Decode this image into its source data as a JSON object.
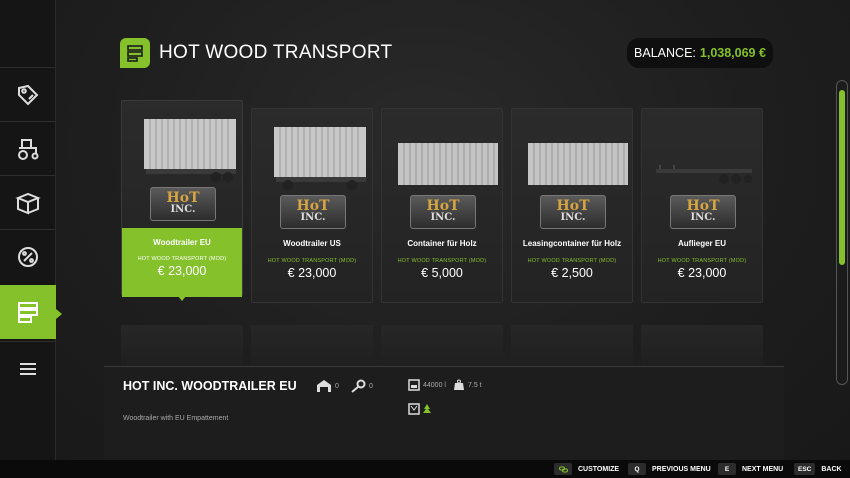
{
  "header": {
    "title": "HOT WOOD TRANSPORT",
    "balance_label": "BALANCE:",
    "balance_value": "1,038,069 €"
  },
  "colors": {
    "accent": "#84c12b",
    "background": "#1c1c1c"
  },
  "sidebar": {
    "items": [
      {
        "icon": "price-tag-icon",
        "active": false
      },
      {
        "icon": "tractor-icon",
        "active": false
      },
      {
        "icon": "box-icon",
        "active": false
      },
      {
        "icon": "percent-gear-icon",
        "active": false
      },
      {
        "icon": "shop-list-icon",
        "active": true
      },
      {
        "icon": "menu-lines-icon",
        "active": false
      }
    ]
  },
  "cards": [
    {
      "name": "Woodtrailer EU",
      "mod": "HOT WOOD TRANSPORT (MOD)",
      "price": "€ 23,000",
      "selected": true
    },
    {
      "name": "Woodtrailer US",
      "mod": "HOT WOOD TRANSPORT (MOD)",
      "price": "€ 23,000",
      "selected": false
    },
    {
      "name": "Container für Holz",
      "mod": "HOT WOOD TRANSPORT (MOD)",
      "price": "€ 5,000",
      "selected": false
    },
    {
      "name": "Leasingcontainer für Holz",
      "mod": "HOT WOOD TRANSPORT (MOD)",
      "price": "€ 2,500",
      "selected": false
    },
    {
      "name": "Auflieger EU",
      "mod": "HOT WOOD TRANSPORT (MOD)",
      "price": "€ 23,000",
      "selected": false
    }
  ],
  "logo": {
    "top": "HoT",
    "bottom": "INC."
  },
  "details": {
    "title": "HOT INC. WOODTRAILER EU",
    "subtitle": "Woodtrailer with EU Empattement",
    "garage_count": "0",
    "key_count": "0",
    "capacity": "44000 l",
    "weight": "7.5 t"
  },
  "footer": {
    "buttons": [
      {
        "key": "",
        "label": "CUSTOMIZE"
      },
      {
        "key": "Q",
        "label": "PREVIOUS MENU"
      },
      {
        "key": "E",
        "label": "NEXT MENU"
      },
      {
        "key": "ESC",
        "label": "BACK"
      }
    ]
  }
}
